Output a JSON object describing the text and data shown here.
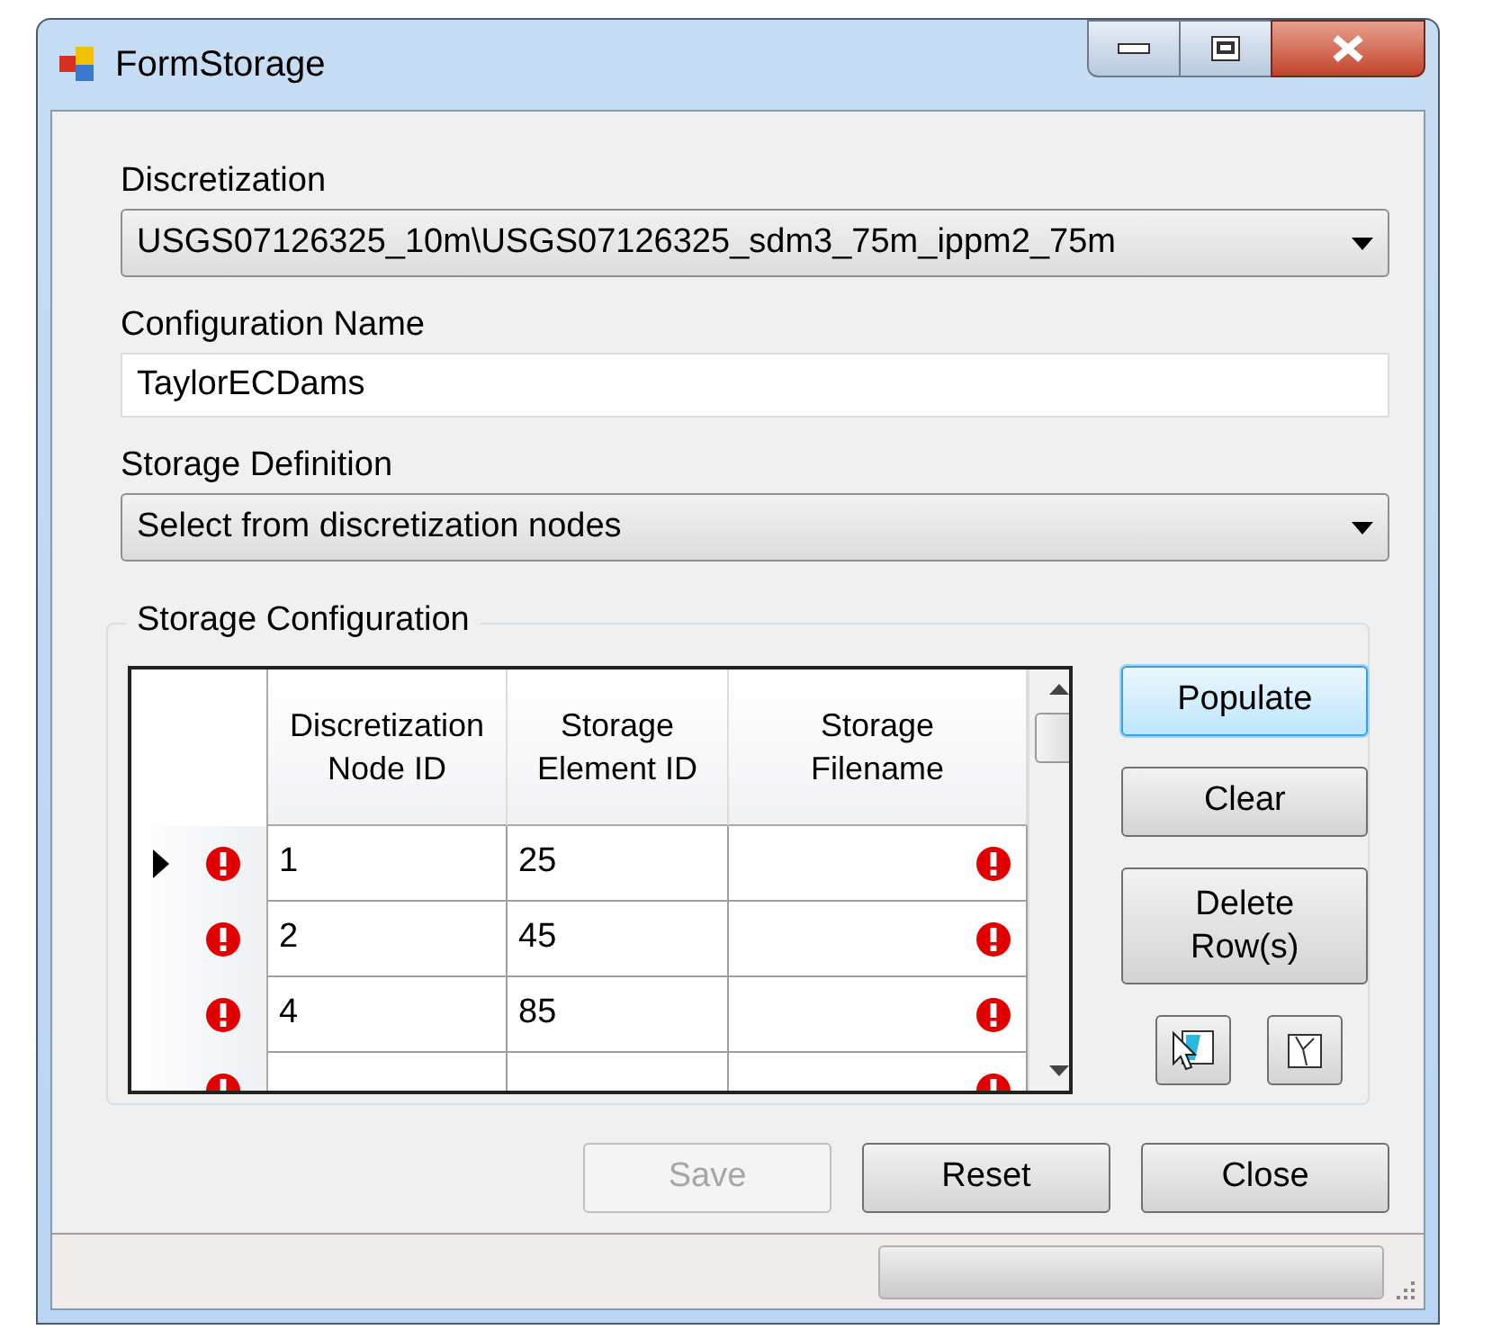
{
  "window": {
    "title": "FormStorage"
  },
  "discretization": {
    "label": "Discretization",
    "value": "USGS07126325_10m\\USGS07126325_sdm3_75m_ippm2_75m"
  },
  "configuration_name": {
    "label": "Configuration Name",
    "value": "TaylorECDams"
  },
  "storage_definition": {
    "label": "Storage Definition",
    "value": "Select from discretization nodes"
  },
  "storage_configuration": {
    "title": "Storage Configuration",
    "columns": [
      "Discretization Node ID",
      "Storage Element ID",
      "Storage Filename"
    ],
    "rows": [
      {
        "node_id": "1",
        "element_id": "25",
        "selected": true,
        "row_error": true,
        "filename_error": true
      },
      {
        "node_id": "2",
        "element_id": "45",
        "selected": false,
        "row_error": true,
        "filename_error": true
      },
      {
        "node_id": "4",
        "element_id": "85",
        "selected": false,
        "row_error": true,
        "filename_error": true
      },
      {
        "selected": false,
        "row_error": true,
        "filename_error": true
      }
    ],
    "buttons": [
      {
        "label": "Populate",
        "focused": true
      },
      {
        "label": "Clear",
        "focused": false
      },
      {
        "label": "Delete Row(s)",
        "focused": false
      }
    ]
  },
  "bottom_buttons": [
    {
      "label": "Save",
      "disabled": true
    },
    {
      "label": "Reset",
      "disabled": false
    },
    {
      "label": "Close",
      "disabled": false
    }
  ],
  "status_bar": {
    "progress": {
      "level": 0
    }
  }
}
